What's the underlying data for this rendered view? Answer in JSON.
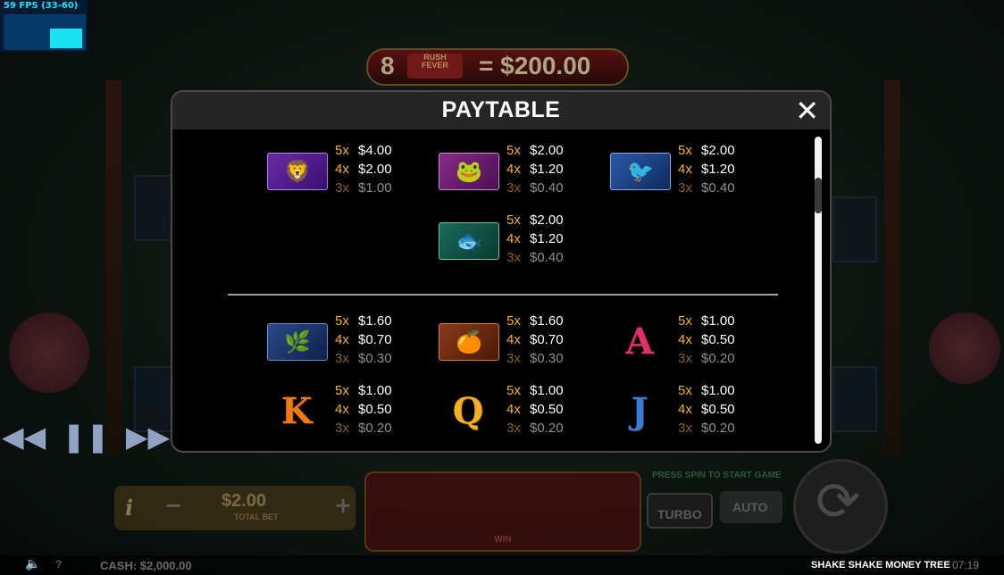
{
  "fps": {
    "label": "59 FPS (33-60)"
  },
  "jackpot": {
    "count": "8",
    "logo_top": "RUSH",
    "logo_bottom": "FEVER",
    "value": "= $200.00"
  },
  "paytable": {
    "title": "PAYTABLE",
    "close_icon": "close-icon",
    "entries": [
      {
        "symbol": "golden-lion-icon",
        "pays": [
          {
            "mult": "5x",
            "amount": "$4.00"
          },
          {
            "mult": "4x",
            "amount": "$2.00"
          },
          {
            "mult": "3x",
            "amount": "$1.00"
          }
        ]
      },
      {
        "symbol": "money-toad-icon",
        "pays": [
          {
            "mult": "5x",
            "amount": "$2.00"
          },
          {
            "mult": "4x",
            "amount": "$1.20"
          },
          {
            "mult": "3x",
            "amount": "$0.40"
          }
        ]
      },
      {
        "symbol": "golden-bird-icon",
        "pays": [
          {
            "mult": "5x",
            "amount": "$2.00"
          },
          {
            "mult": "4x",
            "amount": "$1.20"
          },
          {
            "mult": "3x",
            "amount": "$0.40"
          }
        ]
      },
      {
        "symbol": "koi-fish-icon",
        "pays": [
          {
            "mult": "5x",
            "amount": "$2.00"
          },
          {
            "mult": "4x",
            "amount": "$1.20"
          },
          {
            "mult": "3x",
            "amount": "$0.40"
          }
        ]
      },
      {
        "symbol": "bonsai-plant-icon",
        "pays": [
          {
            "mult": "5x",
            "amount": "$1.60"
          },
          {
            "mult": "4x",
            "amount": "$0.70"
          },
          {
            "mult": "3x",
            "amount": "$0.30"
          }
        ]
      },
      {
        "symbol": "oranges-bowl-icon",
        "pays": [
          {
            "mult": "5x",
            "amount": "$1.60"
          },
          {
            "mult": "4x",
            "amount": "$0.70"
          },
          {
            "mult": "3x",
            "amount": "$0.30"
          }
        ]
      },
      {
        "symbol": "letter-a-icon",
        "letter": "A",
        "pays": [
          {
            "mult": "5x",
            "amount": "$1.00"
          },
          {
            "mult": "4x",
            "amount": "$0.50"
          },
          {
            "mult": "3x",
            "amount": "$0.20"
          }
        ]
      },
      {
        "symbol": "letter-k-icon",
        "letter": "K",
        "pays": [
          {
            "mult": "5x",
            "amount": "$1.00"
          },
          {
            "mult": "4x",
            "amount": "$0.50"
          },
          {
            "mult": "3x",
            "amount": "$0.20"
          }
        ]
      },
      {
        "symbol": "letter-q-icon",
        "letter": "Q",
        "pays": [
          {
            "mult": "5x",
            "amount": "$1.00"
          },
          {
            "mult": "4x",
            "amount": "$0.50"
          },
          {
            "mult": "3x",
            "amount": "$0.20"
          }
        ]
      },
      {
        "symbol": "letter-j-icon",
        "letter": "J",
        "pays": [
          {
            "mult": "5x",
            "amount": "$1.00"
          },
          {
            "mult": "4x",
            "amount": "$0.50"
          },
          {
            "mult": "3x",
            "amount": "$0.20"
          }
        ]
      }
    ]
  },
  "media_controls": {
    "rewind": "rewind-icon",
    "pause": "pause-icon",
    "play": "play-icon",
    "fast_forward": "fast-forward-icon"
  },
  "controls": {
    "info": "i",
    "bet_value": "$2.00",
    "bet_label": "TOTAL BET",
    "minus": "−",
    "plus": "+"
  },
  "win_label": "WIN",
  "press_spin": "PRESS SPIN TO START GAME",
  "turbo": "TURBO",
  "auto": "AUTO",
  "status": {
    "help": "?",
    "cash": "CASH:  $2,000.00",
    "game_name": "SHAKE SHAKE MONEY TREE",
    "clock": "07:19"
  },
  "colors": {
    "multiplier": "#f2b233",
    "amount": "#ffffff",
    "header": "#262626"
  }
}
